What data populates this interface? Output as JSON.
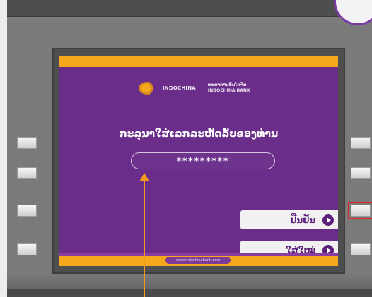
{
  "screen": {
    "logo": {
      "name": "INDOCHINA",
      "name_small": "Bank",
      "lao_name": "ທະນາຄານອິນໂດຈີນ",
      "english_name": "INDOCHINA BANK"
    },
    "prompt": "ກະລຸນາໃສ່ເລກລະຫັດລັບຂອງທ່ານ",
    "pin_value": "*********",
    "buttons": {
      "confirm": "ຢືນຢັນ",
      "reenter": "ໃສ່ໃໝ່"
    },
    "website": "www.indochinabank.com"
  },
  "colors": {
    "screen_bg": "#6a2e8a",
    "accent": "#f4a81c",
    "button_text": "#5b1f7a",
    "selected_outline": "#d9262a",
    "pointer": "#f39a1c"
  }
}
